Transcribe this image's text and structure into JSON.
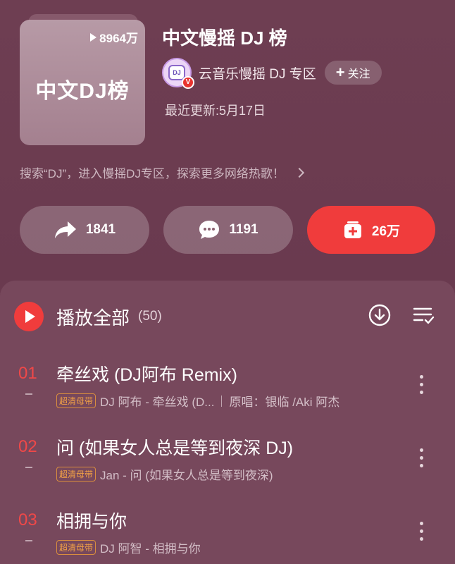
{
  "cover": {
    "play_count": "8964万",
    "title": "中文DJ榜"
  },
  "playlist": {
    "title": "中文慢摇 DJ 榜",
    "creator": "云音乐慢摇 DJ 专区",
    "follow_label": "关注",
    "updated": "最近更新:5月17日",
    "description": "搜索“DJ”，进入慢摇DJ专区，探索更多网络热歌！"
  },
  "actions": {
    "share_count": "1841",
    "comment_count": "1191",
    "collect_count": "26万"
  },
  "list": {
    "play_all_label": "播放全部",
    "count": "(50)",
    "quality_badge": "超清母带",
    "songs": [
      {
        "rank": "01",
        "title": "牵丝戏 (DJ阿布 Remix)",
        "artist_album": "DJ 阿布 - 牵丝戏 (D...",
        "original": "原唱：银临 /Aki 阿杰"
      },
      {
        "rank": "02",
        "title": "问 (如果女人总是等到夜深 DJ)",
        "artist_album": "Jan - 问 (如果女人总是等到夜深)",
        "original": ""
      },
      {
        "rank": "03",
        "title": "相拥与你",
        "artist_album": "DJ 阿智 - 相拥与你",
        "original": ""
      }
    ]
  },
  "colors": {
    "background": "#6a3a4f",
    "accent_red": "#f03c3c",
    "badge_orange": "#f0a046"
  }
}
